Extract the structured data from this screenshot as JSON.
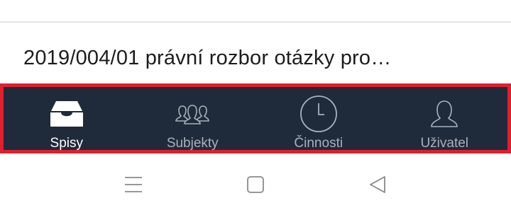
{
  "list": {
    "item_title": "2019/004/01 právní rozbor otázky pro…"
  },
  "tabbar": {
    "tabs": [
      {
        "label": "Spisy",
        "icon": "inbox-icon",
        "active": true
      },
      {
        "label": "Subjekty",
        "icon": "people-icon",
        "active": false
      },
      {
        "label": "Činnosti",
        "icon": "clock-icon",
        "active": false
      },
      {
        "label": "Uživatel",
        "icon": "user-icon",
        "active": false
      }
    ],
    "highlight_color": "#e01f2d",
    "background_color": "#1f2a3a"
  },
  "system_nav": {
    "buttons": [
      "menu-icon",
      "home-icon",
      "back-icon"
    ]
  }
}
